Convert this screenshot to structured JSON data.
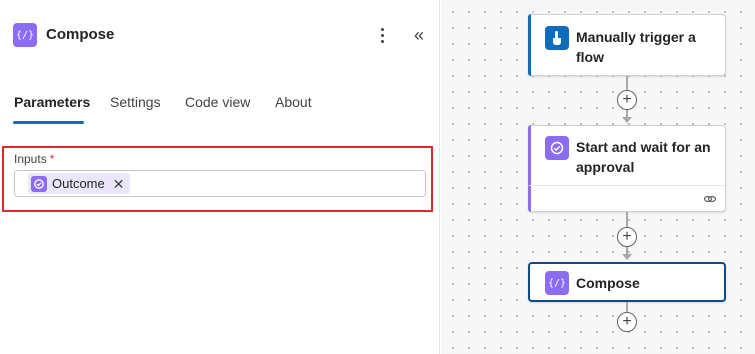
{
  "panel": {
    "title": "Compose",
    "action_icon": "compose-icon",
    "more_icon": "more-vertical-icon",
    "collapse_icon": "chevron-double-left-icon",
    "tabs": [
      {
        "label": "Parameters",
        "active": true
      },
      {
        "label": "Settings",
        "active": false
      },
      {
        "label": "Code view",
        "active": false
      },
      {
        "label": "About",
        "active": false
      }
    ],
    "inputs": {
      "label": "Inputs",
      "required_mark": "*",
      "token": {
        "label": "Outcome",
        "icon": "approval-icon"
      }
    }
  },
  "flow": {
    "nodes": [
      {
        "title": "Manually trigger a flow",
        "icon": "touch-trigger-icon",
        "accent": "#0f6cbd"
      },
      {
        "title": "Start and wait for an approval",
        "icon": "approval-icon",
        "accent": "#8c6cf3",
        "footer_icon": "link-icon"
      },
      {
        "title": "Compose",
        "icon": "compose-icon",
        "accent": "#8c6cf3",
        "selected": true
      }
    ],
    "add_icon": "plus-icon"
  },
  "colors": {
    "brand_blue": "#0f6cbd",
    "action_purple": "#8c6cf3",
    "highlight_red": "#d92c2c"
  }
}
